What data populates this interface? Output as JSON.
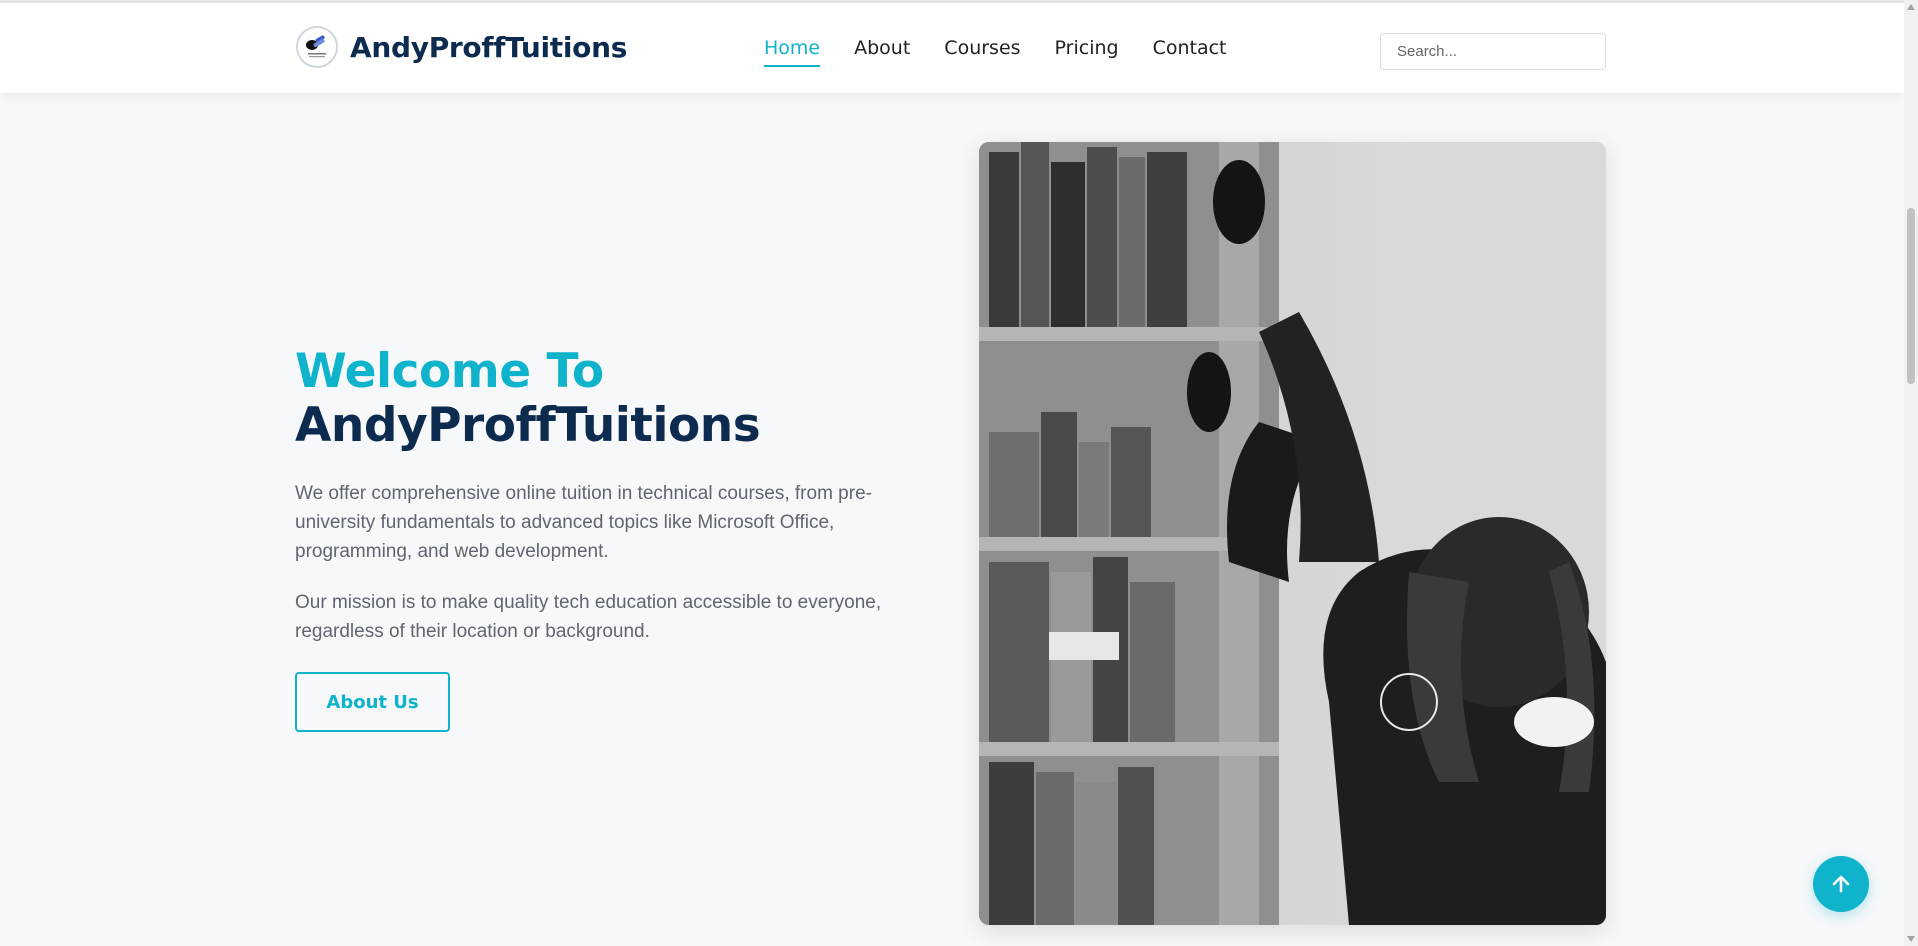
{
  "header": {
    "brand": "AndyProffTuitions",
    "nav": [
      {
        "label": "Home",
        "active": true
      },
      {
        "label": "About",
        "active": false
      },
      {
        "label": "Courses",
        "active": false
      },
      {
        "label": "Pricing",
        "active": false
      },
      {
        "label": "Contact",
        "active": false
      }
    ],
    "search_placeholder": "Search..."
  },
  "hero": {
    "title_line1": "Welcome To",
    "title_line2": "AndyProffTuitions",
    "paragraph1": "We offer comprehensive online tuition in technical courses, from pre-university fundamentals to advanced topics like Microsoft Office, programming, and web development.",
    "paragraph2": "Our mission is to make quality tech education accessible to everyone, regardless of their location or background.",
    "button_label": "About Us",
    "image_icon": "photo-student-library"
  },
  "colors": {
    "accent": "#10b3cc",
    "navy": "#0d2b4f",
    "text_muted": "#5f6670",
    "background": "#f6f8fa"
  },
  "icons": {
    "back_to_top": "arrow-up-icon",
    "logo": "brand-logo-icon"
  }
}
